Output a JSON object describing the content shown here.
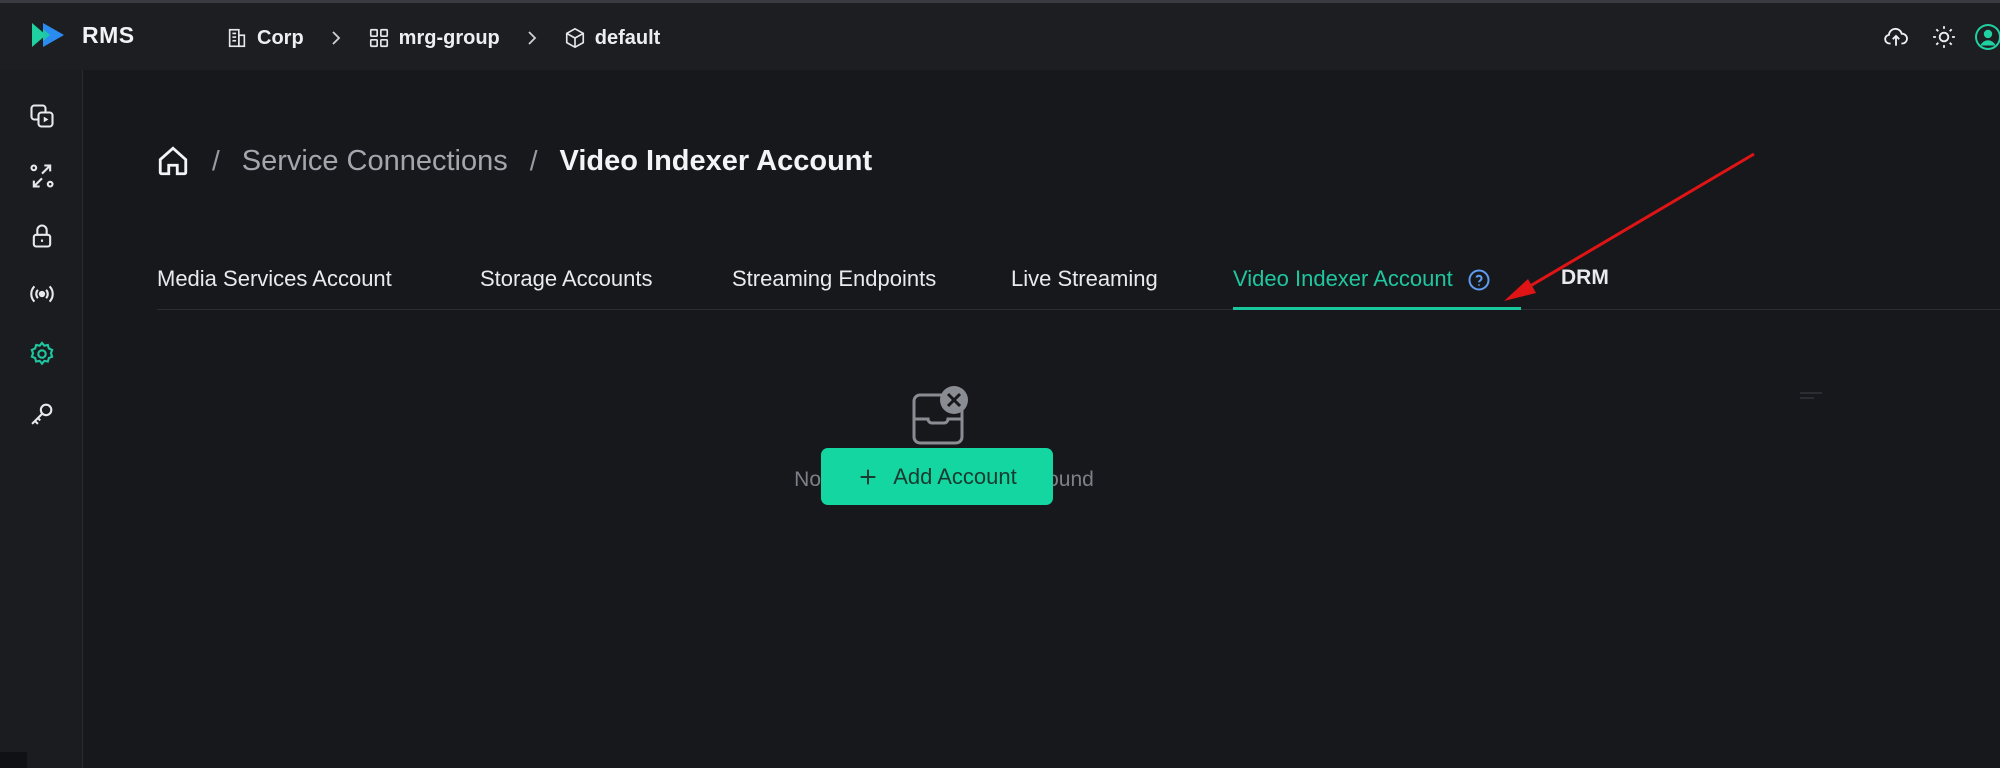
{
  "app": {
    "name": "RMS"
  },
  "topbar": {
    "breadcrumbs": [
      {
        "label": "Corp",
        "icon": "building-icon"
      },
      {
        "label": "mrg-group",
        "icon": "grid-icon"
      },
      {
        "label": "default",
        "icon": "cube-icon"
      }
    ],
    "actions": [
      "cloud-upload-icon",
      "sun-icon",
      "user-avatar-icon"
    ]
  },
  "sidebar": {
    "items": [
      {
        "icon": "media-icon"
      },
      {
        "icon": "connections-icon"
      },
      {
        "icon": "lock-icon"
      },
      {
        "icon": "broadcast-icon"
      },
      {
        "icon": "gear-icon",
        "active": true
      },
      {
        "icon": "key-icon"
      }
    ]
  },
  "page": {
    "breadcrumb": {
      "home_icon": "home-icon",
      "separator": "/",
      "parent": "Service Connections",
      "current": "Video Indexer Account"
    },
    "tabs": [
      {
        "label": "Media Services Account"
      },
      {
        "label": "Storage Accounts"
      },
      {
        "label": "Streaming Endpoints"
      },
      {
        "label": "Live Streaming"
      },
      {
        "label": "Video Indexer Account",
        "active": true,
        "help_icon": "help-circle-icon"
      },
      {
        "label": "DRM"
      }
    ],
    "empty_state": {
      "icon": "empty-inbox-icon",
      "message": "No Video Indexer account found",
      "button_label": "Add Account",
      "button_icon": "plus-icon"
    }
  },
  "colors": {
    "accent": "#18c89c",
    "button_bg": "#13d6a0",
    "background": "#17181c",
    "topbar": "#1d1e22",
    "annotation_arrow": "#e01414"
  }
}
